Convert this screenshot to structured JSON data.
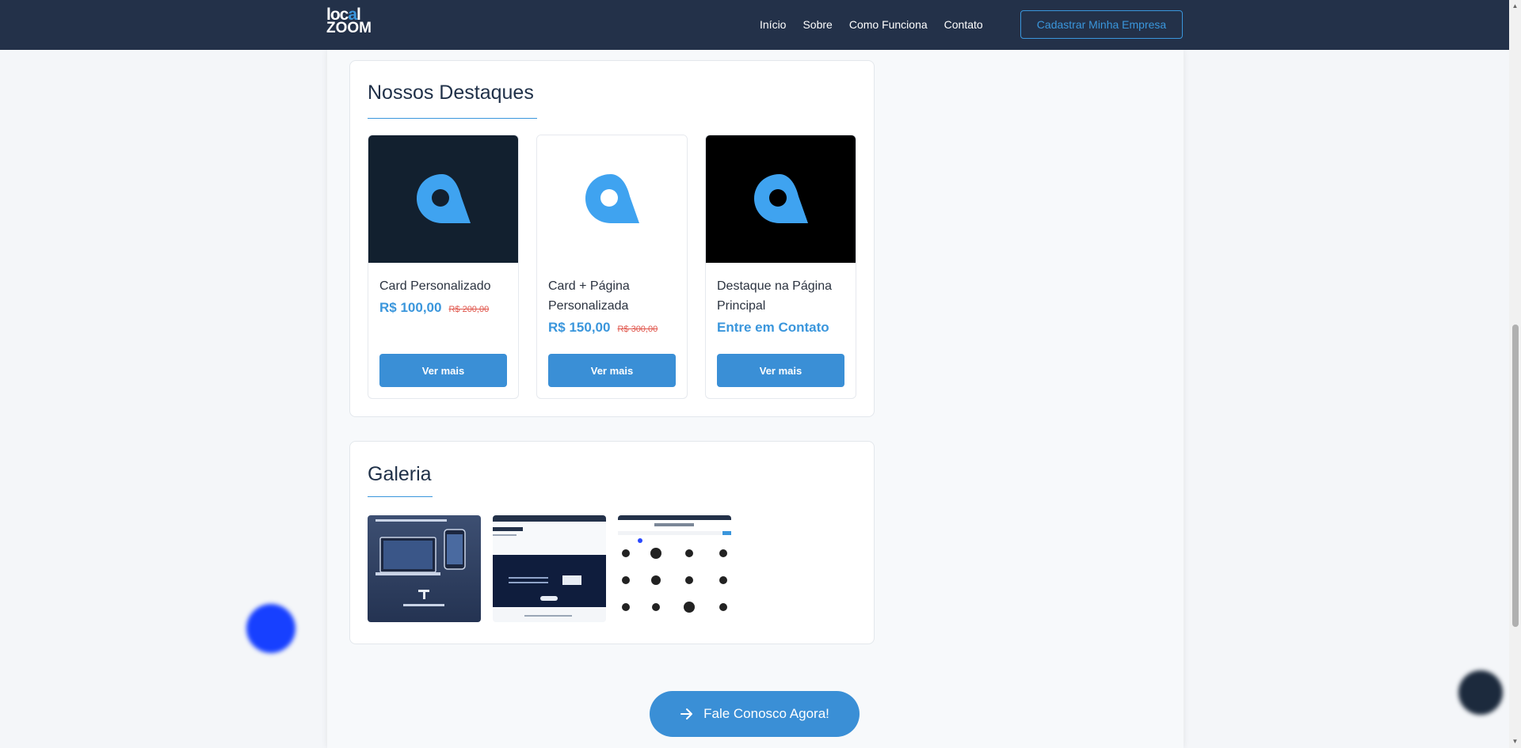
{
  "header": {
    "logo_line1": "local",
    "logo_line2": "ZOOM",
    "nav": [
      "Início",
      "Sobre",
      "Como Funciona",
      "Contato"
    ],
    "cta": "Cadastrar Minha Empresa"
  },
  "highlights": {
    "title": "Nossos Destaques",
    "cards": [
      {
        "name": "Card Personalizado",
        "price": "R$ 100,00",
        "old_price": "R$ 200,00",
        "button": "Ver mais",
        "bg": "#12202f"
      },
      {
        "name": "Card + Página Personalizada",
        "price": "R$ 150,00",
        "old_price": "R$ 300,00",
        "button": "Ver mais",
        "bg": "#ffffff"
      },
      {
        "name": "Destaque na Página Principal",
        "price": "Entre em Contato",
        "old_price": "",
        "button": "Ver mais",
        "bg": "#000000"
      }
    ]
  },
  "gallery": {
    "title": "Galeria"
  },
  "contact_cta": "Fale Conosco Agora!",
  "colors": {
    "header_bg": "#233149",
    "accent": "#3a96dc",
    "old_price": "#e0554b"
  }
}
